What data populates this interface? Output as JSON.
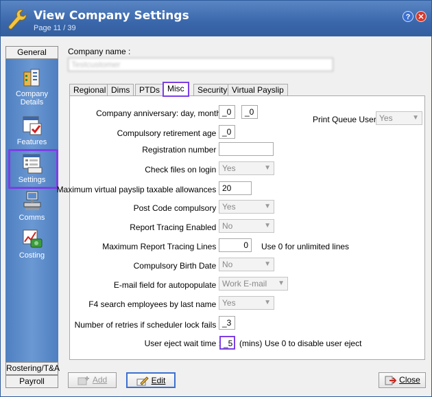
{
  "window": {
    "title": "View Company Settings",
    "subtitle": "Page 11 / 39",
    "help_label": "?",
    "close_label": "✕"
  },
  "sidebar": {
    "general_tab": "General",
    "items": [
      {
        "label1": "Company",
        "label2": "Details",
        "icon": "company-details-icon"
      },
      {
        "label1": "Features",
        "icon": "features-icon"
      },
      {
        "label1": "Settings",
        "icon": "settings-icon"
      },
      {
        "label1": "Comms",
        "icon": "comms-icon"
      },
      {
        "label1": "Costing",
        "icon": "costing-icon"
      }
    ],
    "rostering_tab": "Rostering/T&A",
    "payroll_tab": "Payroll"
  },
  "company": {
    "name_label": "Company name :",
    "name_value": "Testcustomer"
  },
  "tabs": [
    "Regional",
    "Dims",
    "PTDs",
    "Misc",
    "Security",
    "Virtual Payslip"
  ],
  "form": {
    "anniversary_label": "Company anniversary: day, month",
    "anniversary_day": "_0",
    "anniversary_month": "_0",
    "print_queue_label": "Print Queue User :",
    "print_queue_value": "Yes",
    "retirement_label": "Compulsory retirement age :",
    "retirement_value": "_0",
    "registration_label": "Registration number :",
    "registration_value": "",
    "check_files_label": "Check files on login :",
    "check_files_value": "Yes",
    "max_virtual_label": "Maximum virtual payslip taxable allowances :",
    "max_virtual_value": "20",
    "post_code_label": "Post Code compulsory :",
    "post_code_value": "Yes",
    "report_tracing_label": "Report Tracing Enabled :",
    "report_tracing_value": "No",
    "max_tracing_label": "Maximum Report Tracing Lines :",
    "max_tracing_value": "0",
    "max_tracing_hint": "Use 0 for unlimited lines",
    "birth_date_label": "Compulsory Birth Date :",
    "birth_date_value": "No",
    "email_label": "E-mail field for autopopulate :",
    "email_value": "Work E-mail",
    "f4_label": "F4 search employees by last name :",
    "f4_value": "Yes",
    "retries_label": "Number of retries if scheduler lock fails :",
    "retries_value": "_3",
    "eject_label": "User eject wait time :",
    "eject_value": "_5",
    "eject_unit": "(mins)",
    "eject_hint": "Use 0 to disable user eject"
  },
  "buttons": {
    "add": "Add",
    "edit": "Edit",
    "close": "Close"
  },
  "colors": {
    "title_bar": "#3a67ab",
    "sidebar": "#5a8ccd",
    "highlight": "#7b3fe4"
  }
}
